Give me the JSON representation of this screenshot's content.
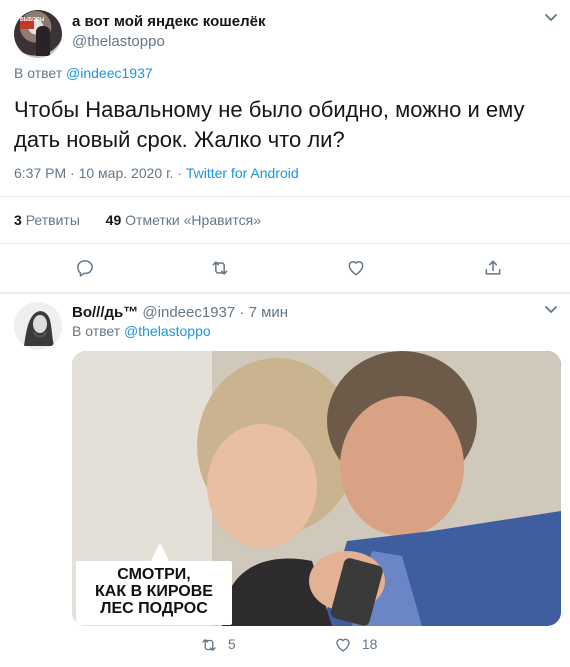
{
  "tweet": {
    "author_name": "а вот мой яндекс кошелёк",
    "author_handle": "@thelastoppo",
    "reply_prefix": "В ответ",
    "reply_to": "@indeec1937",
    "text": "Чтобы Навальному не было обидно, можно и ему дать новый срок. Жалко что ли?",
    "time": "6:37 PM",
    "date": "10 мар. 2020 г.",
    "source": "Twitter for Android",
    "retweets_count": "3",
    "retweets_label": "Ретвиты",
    "likes_count": "49",
    "likes_label": "Отметки «Нравится»",
    "avatar_poster_text": "ВЫБОРЫ"
  },
  "reply": {
    "author_name": "Во///дь™",
    "author_handle": "@indeec1937",
    "time_ago": "7 мин",
    "reply_prefix": "В ответ",
    "reply_to": "@thelastoppo",
    "image_caption": "СМОТРИ,\nКАК В КИРОВЕ\nЛЕС ПОДРОС",
    "retweets": "5",
    "likes": "18"
  },
  "icons": {
    "menu": "chevron-down-icon",
    "reply": "reply-icon",
    "retweet": "retweet-icon",
    "like": "heart-icon",
    "share": "share-icon"
  },
  "colors": {
    "link": "#1b95e0",
    "secondary": "#657786",
    "divider": "#e6ecf0"
  }
}
